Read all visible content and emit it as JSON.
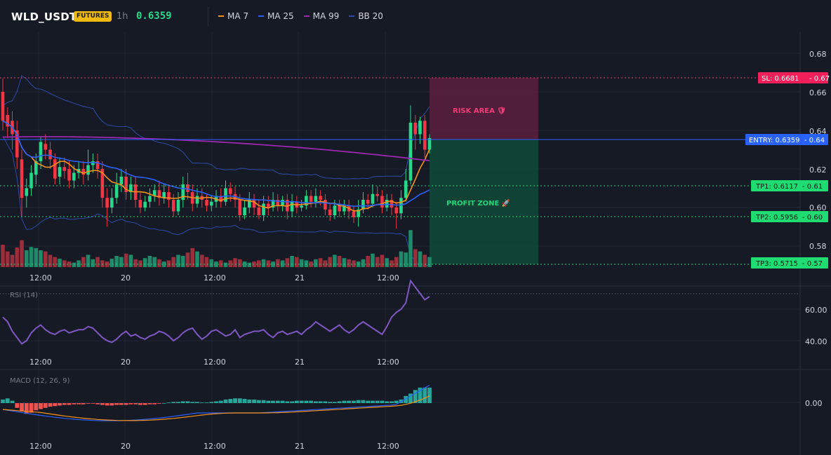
{
  "header": {
    "symbol": "WLD_USDT",
    "badge": "FUTURES",
    "timeframe": "1h",
    "price": "0.6359",
    "indicators": [
      {
        "label": "MA 7",
        "color": "#f7931a"
      },
      {
        "label": "MA 25",
        "color": "#2962ff"
      },
      {
        "label": "MA 99",
        "color": "#9c27b0"
      },
      {
        "label": "BB 20",
        "color": "#1e3a8a"
      }
    ]
  },
  "price_axis": [
    "0.68",
    "0.66",
    "0.64",
    "0.62",
    "0.60",
    "0.58"
  ],
  "time_axis": [
    "12:00",
    "20",
    "12:00",
    "21",
    "12:00"
  ],
  "levels": {
    "sl": {
      "label": "SL: 0.6681",
      "value": "0.67",
      "price": 0.6681
    },
    "entry": {
      "label": "ENTRY: 0.6359",
      "value": "0.64",
      "price": 0.6359
    },
    "tp1": {
      "label": "TP1: 0.6117",
      "value": "0.61",
      "price": 0.6117
    },
    "tp2": {
      "label": "TP2: 0.5956",
      "value": "0.60",
      "price": 0.5956
    },
    "tp3": {
      "label": "TP3: 0.5715",
      "value": "0.57",
      "price": 0.5715
    }
  },
  "zones": {
    "risk": "RISK AREA 🛡",
    "profit": "PROFIT ZONE 🚀"
  },
  "rsi": {
    "title": "RSI (14)",
    "axis": [
      "60.00",
      "40.00"
    ]
  },
  "macd": {
    "title": "MACD (12, 26, 9)",
    "axis": [
      "0.00"
    ]
  },
  "colors": {
    "up": "#26d98a",
    "down": "#f23645",
    "up_vol": "#1f8a6a",
    "down_vol": "#9a2e3a",
    "grid": "#232733",
    "sl": "#f23d6d",
    "entry": "#2962ff",
    "tp": "#22d67a"
  }
}
